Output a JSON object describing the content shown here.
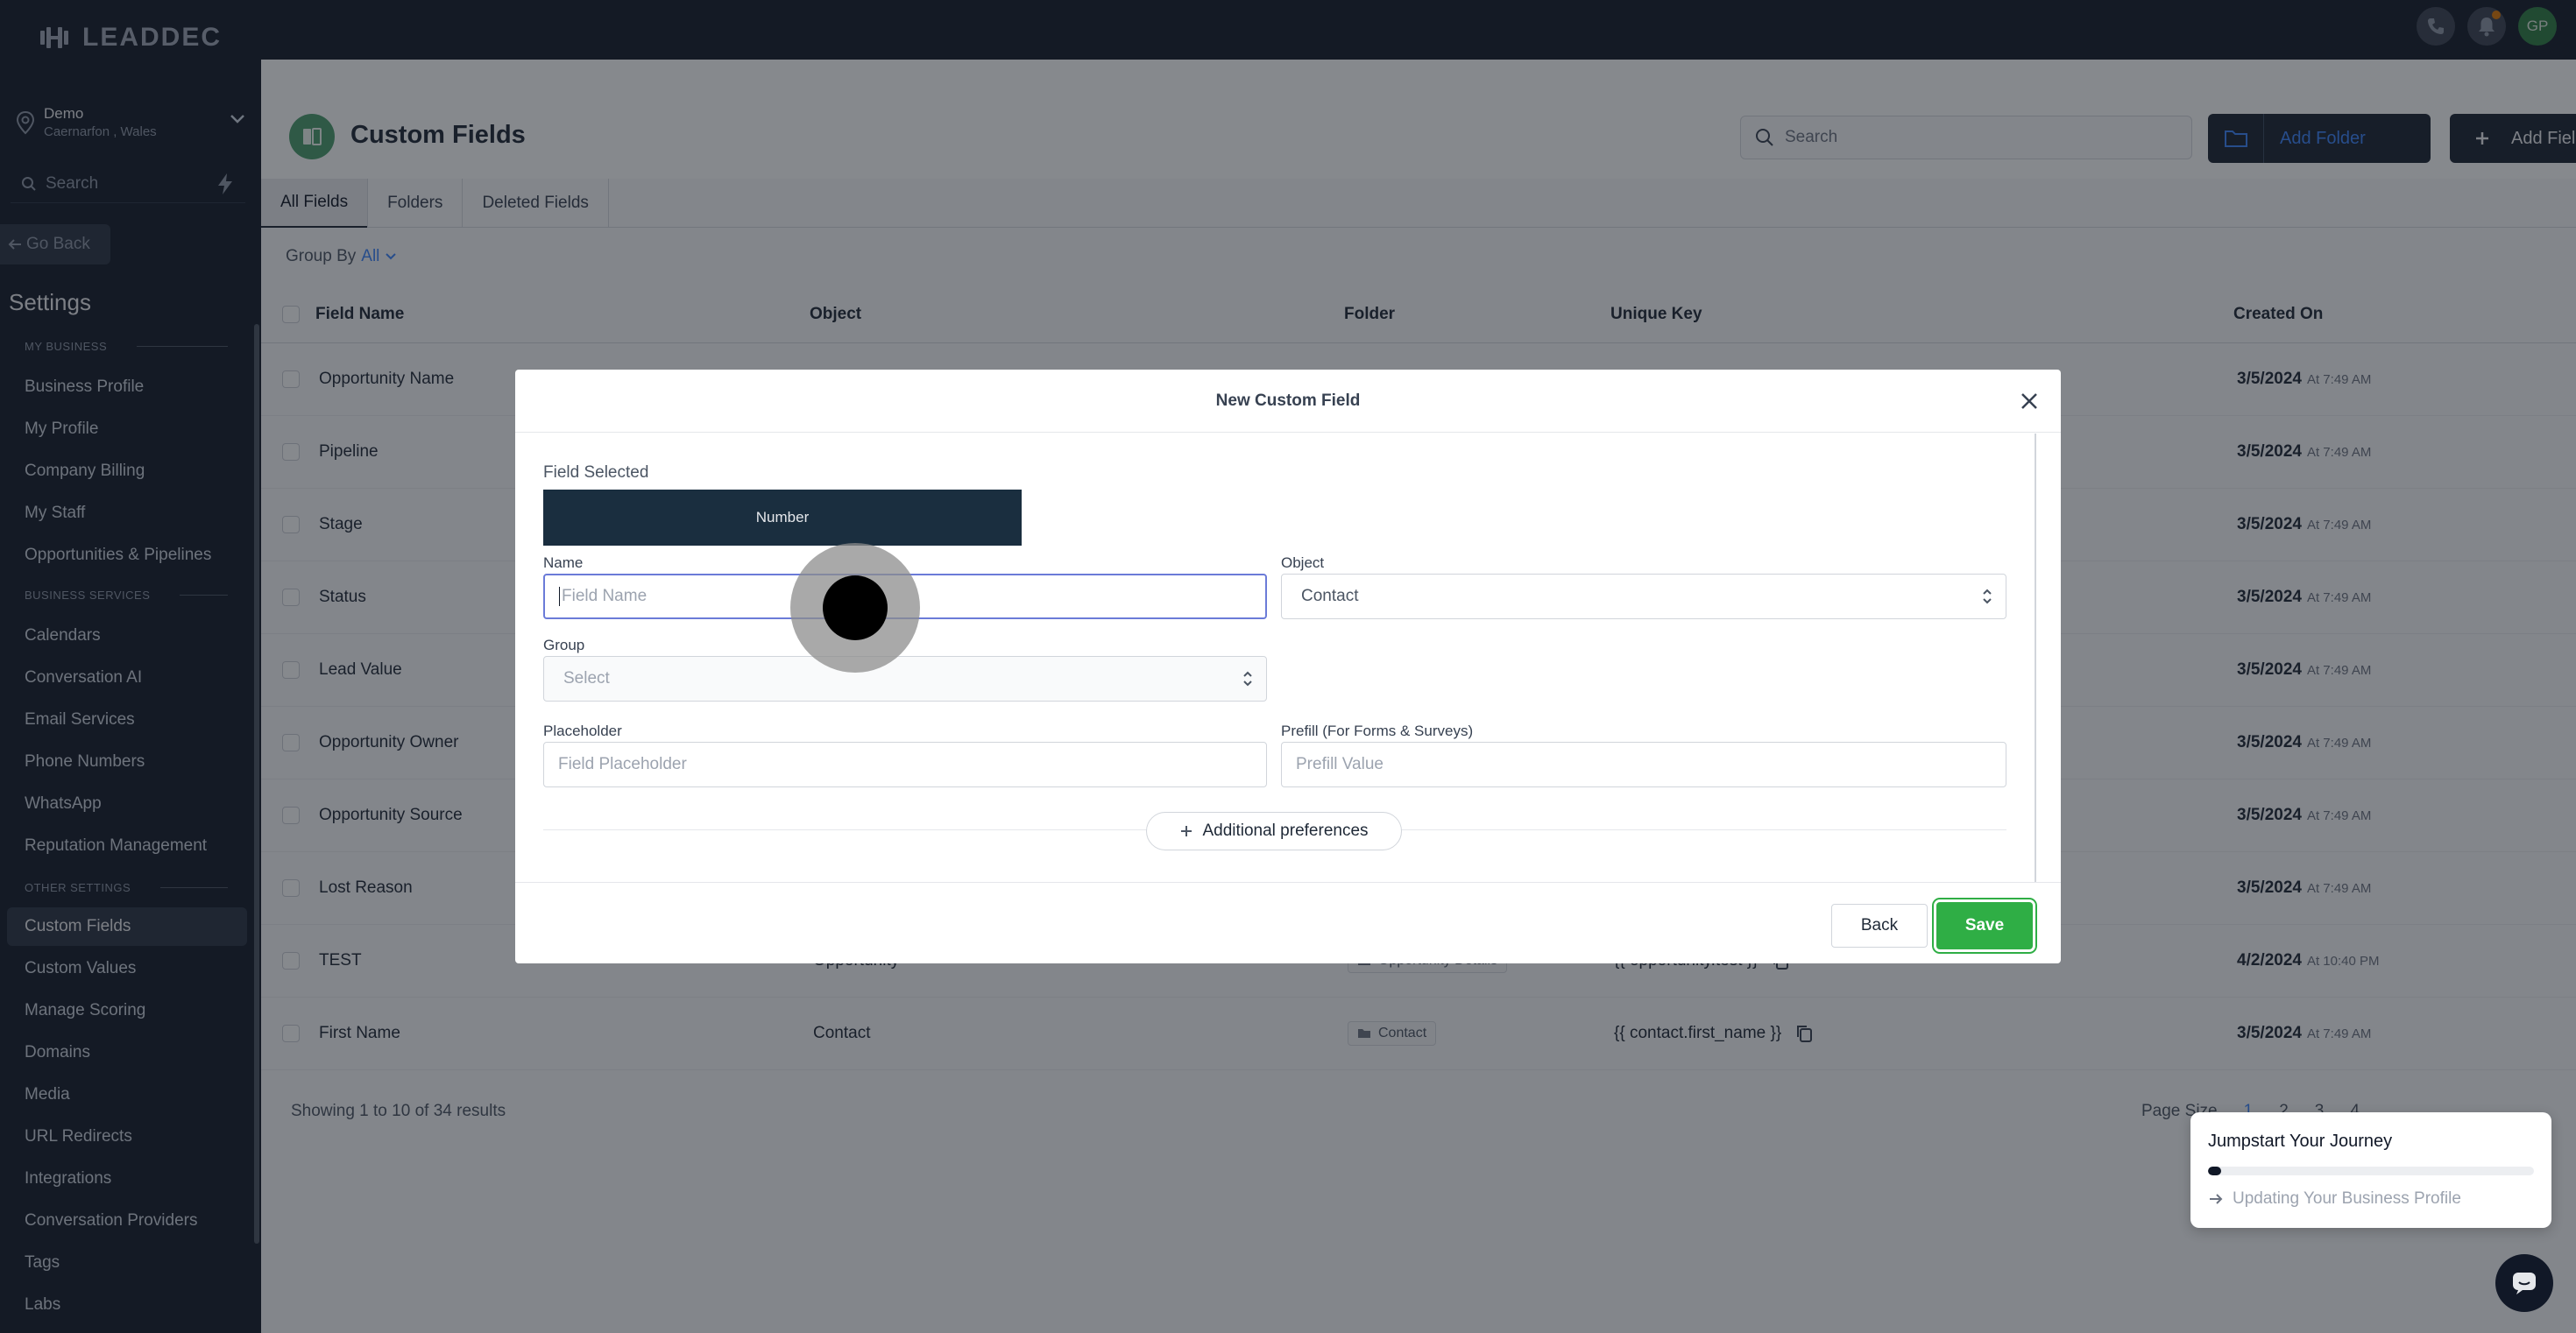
{
  "brand": {
    "logo_text": "LEADDEC"
  },
  "location": {
    "name": "Demo",
    "sub": "Caernarfon , Wales"
  },
  "sidebar": {
    "search_placeholder": "Search",
    "go_back": "Go Back",
    "settings_title": "Settings",
    "sections": [
      {
        "label": "MY BUSINESS",
        "items": [
          "Business Profile",
          "My Profile",
          "Company Billing",
          "My Staff",
          "Opportunities & Pipelines"
        ]
      },
      {
        "label": "BUSINESS SERVICES",
        "items": [
          "Calendars",
          "Conversation AI",
          "Email Services",
          "Phone Numbers",
          "WhatsApp",
          "Reputation Management"
        ]
      },
      {
        "label": "OTHER SETTINGS",
        "items": [
          "Custom Fields",
          "Custom Values",
          "Manage Scoring",
          "Domains",
          "Media",
          "URL Redirects",
          "Integrations",
          "Conversation Providers",
          "Tags",
          "Labs"
        ]
      }
    ],
    "active_item": "Custom Fields"
  },
  "topbar": {
    "avatar_initials": "GP"
  },
  "page": {
    "title": "Custom Fields",
    "search_placeholder": "Search",
    "add_folder": "Add Folder",
    "add_field": "Add Field",
    "tabs": [
      "All Fields",
      "Folders",
      "Deleted Fields"
    ],
    "group_by_label": "Group By",
    "group_by_value": "All"
  },
  "table": {
    "headers": [
      "Field Name",
      "Object",
      "Folder",
      "Unique Key",
      "Created On"
    ],
    "rows": [
      {
        "name": "Opportunity Name",
        "object": "",
        "folder": "",
        "key": "",
        "date": "3/5/2024",
        "time": "At 7:49 AM"
      },
      {
        "name": "Pipeline",
        "object": "",
        "folder": "",
        "key": "",
        "date": "3/5/2024",
        "time": "At 7:49 AM"
      },
      {
        "name": "Stage",
        "object": "",
        "folder": "",
        "key": "",
        "date": "3/5/2024",
        "time": "At 7:49 AM"
      },
      {
        "name": "Status",
        "object": "",
        "folder": "",
        "key": "",
        "date": "3/5/2024",
        "time": "At 7:49 AM"
      },
      {
        "name": "Lead Value",
        "object": "",
        "folder": "",
        "key": "",
        "date": "3/5/2024",
        "time": "At 7:49 AM"
      },
      {
        "name": "Opportunity Owner",
        "object": "",
        "folder": "",
        "key": "",
        "date": "3/5/2024",
        "time": "At 7:49 AM"
      },
      {
        "name": "Opportunity Source",
        "object": "",
        "folder": "",
        "key": "",
        "date": "3/5/2024",
        "time": "At 7:49 AM"
      },
      {
        "name": "Lost Reason",
        "object": "",
        "folder": "",
        "key": "",
        "date": "3/5/2024",
        "time": "At 7:49 AM"
      },
      {
        "name": "TEST",
        "object": "Opportunity",
        "folder": "Opportunity Details",
        "key": "{{ opportunity.test }}",
        "date": "4/2/2024",
        "time": "At 10:40 PM"
      },
      {
        "name": "First Name",
        "object": "Contact",
        "folder": "Contact",
        "key": "{{ contact.first_name }}",
        "date": "3/5/2024",
        "time": "At 7:49 AM"
      }
    ],
    "showing_prefix": "Showing",
    "showing_from": "1",
    "showing_to_word": "to",
    "showing_to": "10",
    "showing_of_word": "of",
    "showing_total": "34",
    "showing_suffix": "results",
    "page_size_label": "Page Size",
    "pages": [
      "1",
      "2",
      "3",
      "4"
    ]
  },
  "modal": {
    "title": "New Custom Field",
    "field_selected_label": "Field Selected",
    "field_type": "Number",
    "name_label": "Name",
    "name_placeholder": "Field Name",
    "object_label": "Object",
    "object_value": "Contact",
    "group_label": "Group",
    "group_placeholder": "Select",
    "placeholder_label": "Placeholder",
    "placeholder_placeholder": "Field Placeholder",
    "prefill_label": "Prefill (For Forms & Surveys)",
    "prefill_placeholder": "Prefill Value",
    "additional": "Additional preferences",
    "back": "Back",
    "save": "Save"
  },
  "journey": {
    "title": "Jumpstart Your Journey",
    "progress_fraction": 0.04,
    "step": "Updating Your Business Profile"
  }
}
